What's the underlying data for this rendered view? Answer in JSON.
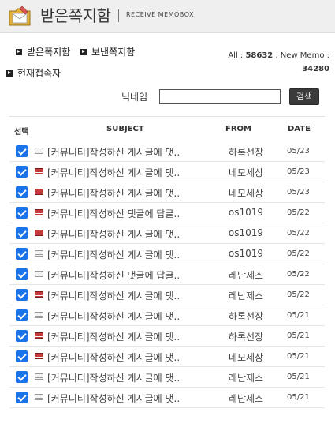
{
  "header": {
    "title": "받은쪽지함",
    "subtitle": "RECEIVE MEMOBOX"
  },
  "nav": {
    "inbox": "받은쪽지함",
    "sent": "보낸쪽지함",
    "online": "현재접속자"
  },
  "stats": {
    "all_label": "All :",
    "all_value": "58632",
    "new_label": ", New Memo :",
    "new_value": "34280"
  },
  "search": {
    "label": "닉네임",
    "value": "",
    "button": "검색"
  },
  "table": {
    "headers": {
      "select": "선택",
      "subject": "SUBJECT",
      "from": "FROM",
      "date": "DATE"
    },
    "rows": [
      {
        "subject": "[커뮤니티]작성하신 게시글에 댓..",
        "from": "하록선장",
        "date": "05/23",
        "read": true,
        "checked": true
      },
      {
        "subject": "[커뮤니티]작성하신 게시글에 댓..",
        "from": "네모세상",
        "date": "05/23",
        "read": false,
        "checked": true
      },
      {
        "subject": "[커뮤니티]작성하신 게시글에 댓..",
        "from": "네모세상",
        "date": "05/23",
        "read": false,
        "checked": true
      },
      {
        "subject": "[커뮤니티]작성하신 댓글에 답글..",
        "from": "os1019",
        "date": "05/22",
        "read": false,
        "checked": true
      },
      {
        "subject": "[커뮤니티]작성하신 게시글에 댓..",
        "from": "os1019",
        "date": "05/22",
        "read": false,
        "checked": true
      },
      {
        "subject": "[커뮤니티]작성하신 게시글에 댓..",
        "from": "os1019",
        "date": "05/22",
        "read": true,
        "checked": true
      },
      {
        "subject": "[커뮤니티]작성하신 댓글에 답글..",
        "from": "레난제스",
        "date": "05/22",
        "read": true,
        "checked": true
      },
      {
        "subject": "[커뮤니티]작성하신 게시글에 댓..",
        "from": "레난제스",
        "date": "05/22",
        "read": false,
        "checked": true
      },
      {
        "subject": "[커뮤니티]작성하신 게시글에 댓..",
        "from": "하록선장",
        "date": "05/21",
        "read": true,
        "checked": true
      },
      {
        "subject": "[커뮤니티]작성하신 게시글에 댓..",
        "from": "하록선장",
        "date": "05/21",
        "read": false,
        "checked": true
      },
      {
        "subject": "[커뮤니티]작성하신 게시글에 댓..",
        "from": "네모세상",
        "date": "05/21",
        "read": false,
        "checked": true
      },
      {
        "subject": "[커뮤니티]작성하신 게시글에 댓..",
        "from": "레난제스",
        "date": "05/21",
        "read": true,
        "checked": true
      },
      {
        "subject": "[커뮤니티]작성하신 게시글에 댓..",
        "from": "레난제스",
        "date": "05/21",
        "read": true,
        "checked": true
      }
    ]
  },
  "colors": {
    "checkbox": "#1a73e8",
    "unread_icon": "#c43a3a",
    "header_bg": "#efefef",
    "button_bg": "#3b3b3b"
  }
}
